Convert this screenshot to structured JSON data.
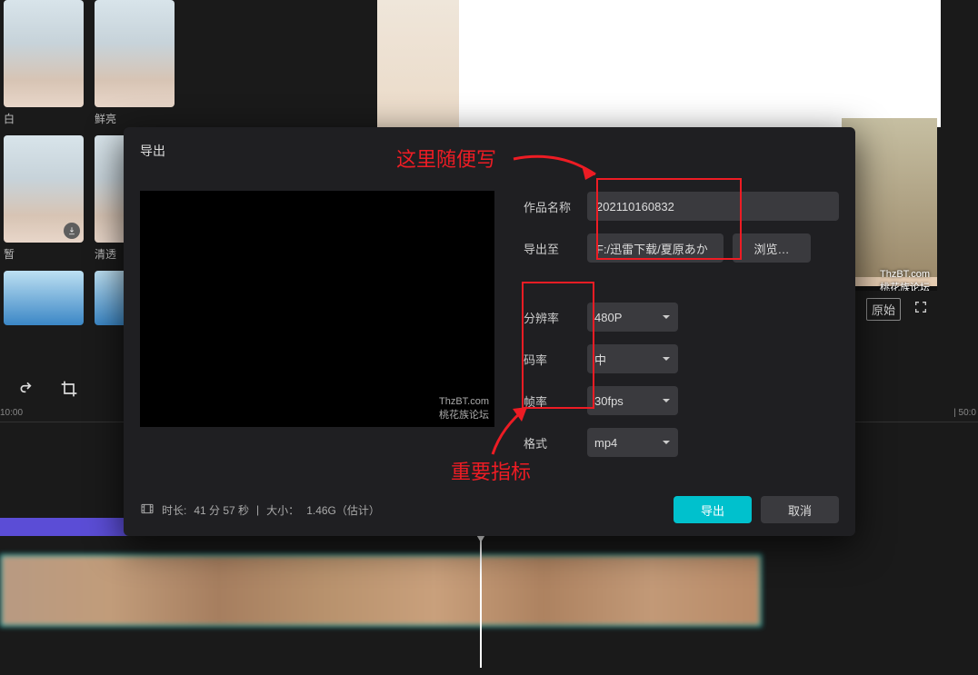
{
  "effects": {
    "items": [
      {
        "label": "白"
      },
      {
        "label": "鲜亮"
      },
      {
        "label": "暂"
      },
      {
        "label": "清透"
      }
    ]
  },
  "preview": {
    "watermark_line1": "ThzBT.com",
    "watermark_line2": "桃花族论坛",
    "original_btn": "原始"
  },
  "timeline": {
    "left_tick": "10:00",
    "right_tick": "| 50:0"
  },
  "dialog": {
    "title": "导出",
    "preview_wm1": "ThzBT.com",
    "preview_wm2": "桃花族论坛",
    "fields": {
      "name_label": "作品名称",
      "name_value": "202110160832",
      "path_label": "导出至",
      "path_value": "F:/迅雷下载/夏原あか",
      "browse": "浏览…",
      "resolution_label": "分辨率",
      "resolution_value": "480P",
      "bitrate_label": "码率",
      "bitrate_value": "中",
      "fps_label": "帧率",
      "fps_value": "30fps",
      "format_label": "格式",
      "format_value": "mp4"
    },
    "meta": {
      "duration_label": "时长:",
      "duration_value": "41 分 57 秒",
      "sep": "|",
      "size_label": "大小：",
      "size_value": "1.46G（估计）"
    },
    "export_btn": "导出",
    "cancel_btn": "取消"
  },
  "annotations": {
    "top_text": "这里随便写",
    "bottom_text": "重要指标"
  }
}
